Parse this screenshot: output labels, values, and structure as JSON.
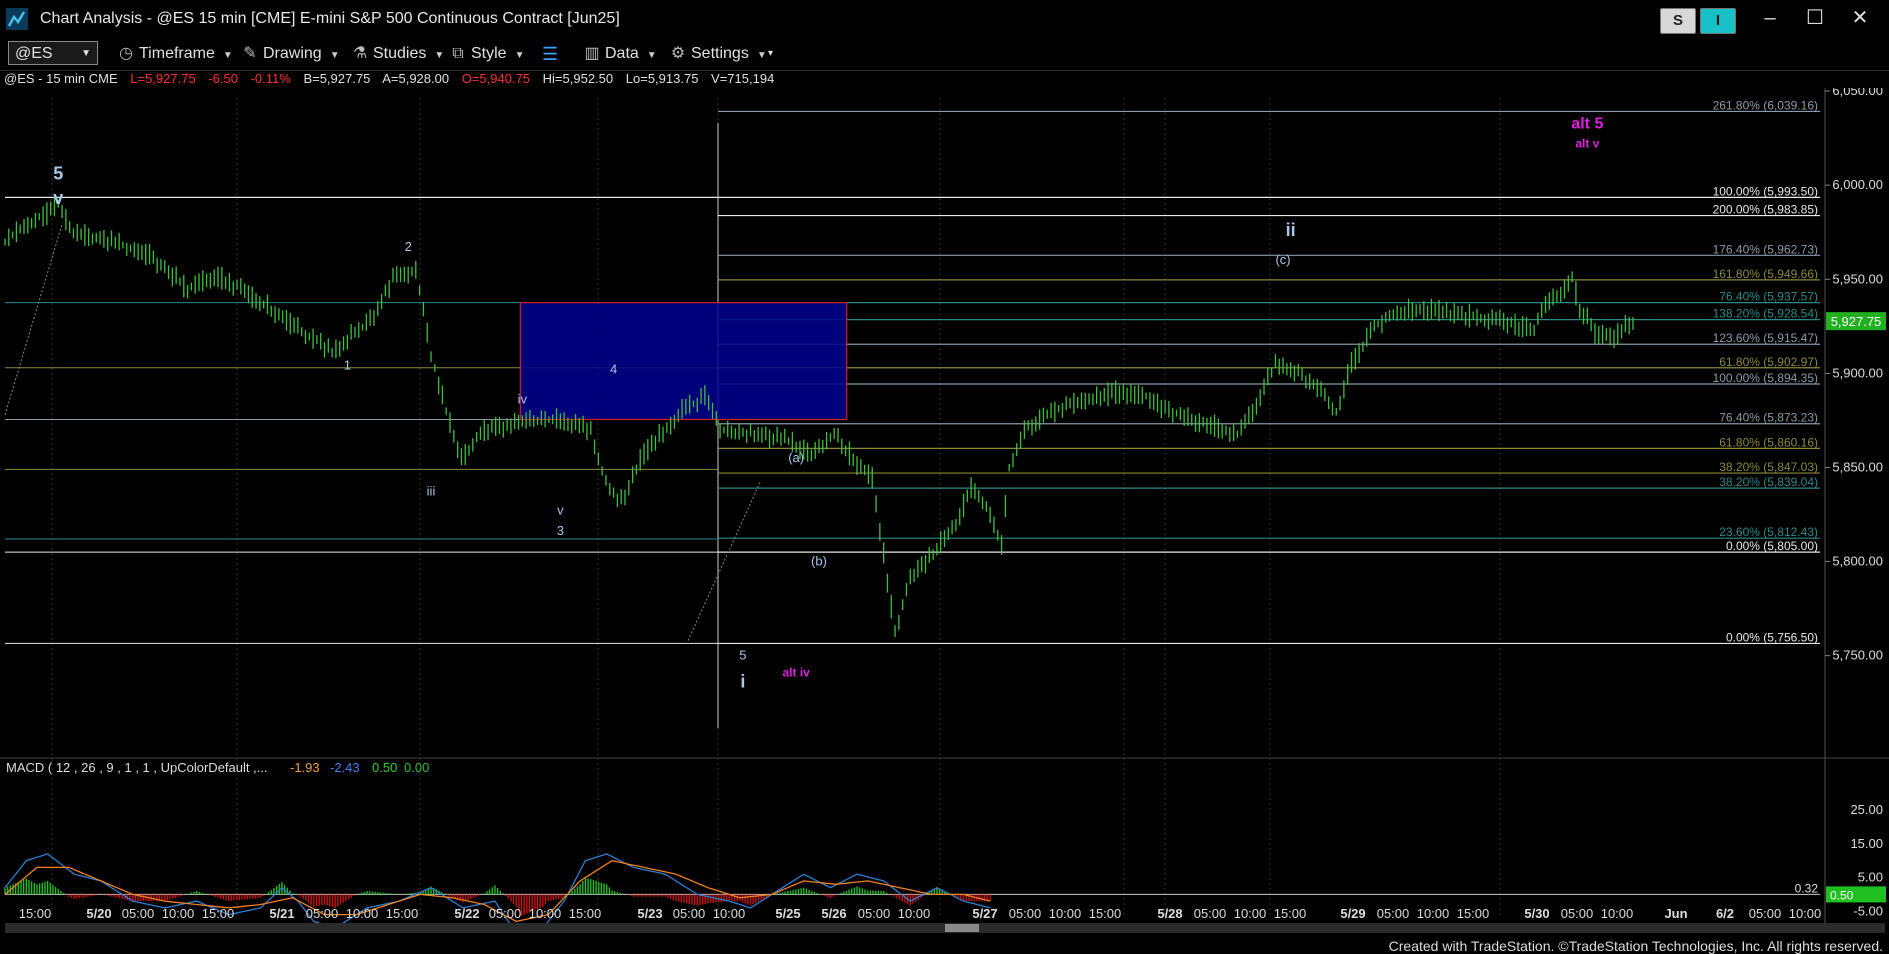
{
  "window": {
    "title": "Chart Analysis - @ES 15 min [CME] E-mini S&P 500 Continuous Contract [Jun25]",
    "s_button": "S",
    "i_button": "I",
    "minimize": "–",
    "maximize": "☐",
    "close": "✕"
  },
  "toolbar": {
    "symbol": "@ES",
    "timeframe_label": "Timeframe",
    "drawing_label": "Drawing",
    "studies_label": "Studies",
    "style_label": "Style",
    "data_label": "Data",
    "settings_label": "Settings"
  },
  "infobar": {
    "symbol": "@ES - 15 min  CME",
    "last": "L=5,927.75",
    "change": "-6.50",
    "pct": "-0.11%",
    "bid": "B=5,927.75",
    "ask": "A=5,928.00",
    "open": "O=5,940.75",
    "high": "Hi=5,952.50",
    "low": "Lo=5,913.75",
    "volume": "V=715,194"
  },
  "colors": {
    "background": "#000000",
    "price": "#3fbf3f",
    "white_line": "#e8e8e8",
    "gray_line": "#8a9aa8",
    "olive_line": "#8a8a3a",
    "teal_line": "#2a8a8a",
    "box_fill": "#00008f",
    "box_border": "#d02020",
    "magenta": "#e020e0",
    "wave_label": "#a8c8e8",
    "neg": "#ff3030",
    "pos": "#30d030",
    "last_price_bg": "#20b020",
    "macd_line": "#2a7fd4",
    "signal_line": "#f08020",
    "hist_pos": "#20c020",
    "hist_neg": "#d01010"
  },
  "chart_data": {
    "type": "line",
    "title": "@ES - 15 min CME",
    "price_axis_ticks": [
      "6,050.00",
      "6,000.00",
      "5,950.00",
      "5,900.00",
      "5,850.00",
      "5,800.00",
      "5,750.00"
    ],
    "y_range": [
      5702,
      6058
    ],
    "last_price_label": "5,927.75",
    "time_axis_ticks": [
      "15:00",
      "5/20",
      "05:00",
      "10:00",
      "15:00",
      "5/21",
      "05:00",
      "10:00",
      "15:00",
      "5/22",
      "05:00",
      "10:00",
      "15:00",
      "5/23",
      "05:00",
      "10:00",
      "5/25",
      "5/26",
      "05:00",
      "10:00",
      "5/27",
      "05:00",
      "10:00",
      "15:00",
      "5/28",
      "05:00",
      "10:00",
      "15:00",
      "5/29",
      "05:00",
      "10:00",
      "15:00",
      "5/30",
      "05:00",
      "10:00",
      "Jun",
      "6/2",
      "05:00",
      "10:00"
    ],
    "price_series_anchors": [
      [
        0,
        5970
      ],
      [
        3,
        5980
      ],
      [
        6,
        5986
      ],
      [
        7,
        5990
      ],
      [
        9,
        5975
      ],
      [
        14,
        5970
      ],
      [
        19,
        5963
      ],
      [
        24,
        5945
      ],
      [
        28,
        5952
      ],
      [
        33,
        5940
      ],
      [
        38,
        5925
      ],
      [
        43,
        5912
      ],
      [
        48,
        5928
      ],
      [
        51,
        5950
      ],
      [
        54,
        5955
      ],
      [
        56,
        5910
      ],
      [
        58,
        5880
      ],
      [
        60,
        5855
      ],
      [
        63,
        5870
      ],
      [
        68,
        5874
      ],
      [
        73,
        5876
      ],
      [
        77,
        5870
      ],
      [
        79,
        5842
      ],
      [
        81,
        5832
      ],
      [
        84,
        5858
      ],
      [
        89,
        5880
      ],
      [
        92,
        5888
      ],
      [
        94,
        5870
      ],
      [
        98,
        5868
      ],
      [
        103,
        5864
      ],
      [
        106,
        5856
      ],
      [
        109,
        5868
      ],
      [
        112,
        5852
      ],
      [
        114,
        5845
      ],
      [
        116,
        5790
      ],
      [
        117,
        5762
      ],
      [
        119,
        5790
      ],
      [
        122,
        5805
      ],
      [
        125,
        5820
      ],
      [
        127,
        5840
      ],
      [
        129,
        5830
      ],
      [
        131,
        5808
      ],
      [
        132,
        5850
      ],
      [
        134,
        5870
      ],
      [
        138,
        5880
      ],
      [
        142,
        5886
      ],
      [
        146,
        5890
      ],
      [
        150,
        5888
      ],
      [
        153,
        5880
      ],
      [
        156,
        5876
      ],
      [
        159,
        5872
      ],
      [
        162,
        5868
      ],
      [
        164,
        5880
      ],
      [
        167,
        5905
      ],
      [
        170,
        5900
      ],
      [
        173,
        5890
      ],
      [
        175,
        5880
      ],
      [
        177,
        5905
      ],
      [
        180,
        5925
      ],
      [
        183,
        5932
      ],
      [
        186,
        5935
      ],
      [
        190,
        5932
      ],
      [
        194,
        5930
      ],
      [
        198,
        5926
      ],
      [
        201,
        5924
      ],
      [
        203,
        5940
      ],
      [
        205,
        5945
      ],
      [
        206,
        5950
      ],
      [
        207,
        5935
      ],
      [
        209,
        5922
      ],
      [
        211,
        5918
      ],
      [
        214,
        5928
      ]
    ],
    "fib_levels": [
      {
        "label": "261.80% (6,039.16)",
        "value": 6039.16,
        "color": "gray"
      },
      {
        "label": "100.00% (5,993.50)",
        "value": 5993.5,
        "color": "white"
      },
      {
        "label": "200.00% (5,983.85)",
        "value": 5983.85,
        "color": "white"
      },
      {
        "label": "176.40% (5,962.73)",
        "value": 5962.73,
        "color": "gray"
      },
      {
        "label": "161.80% (5,949.66)",
        "value": 5949.66,
        "color": "olive"
      },
      {
        "label": "76.40% (5,937.57)",
        "value": 5937.57,
        "color": "teal"
      },
      {
        "label": "138.20% (5,928.54)",
        "value": 5928.54,
        "color": "teal"
      },
      {
        "label": "123.60% (5,915.47)",
        "value": 5915.47,
        "color": "gray"
      },
      {
        "label": "61.80% (5,902.97)",
        "value": 5902.97,
        "color": "olive"
      },
      {
        "label": "100.00% (5,894.35)",
        "value": 5894.35,
        "color": "gray"
      },
      {
        "label": "76.40% (5,873.23)",
        "value": 5873.23,
        "color": "gray"
      },
      {
        "label": "61.80% (5,860.16)",
        "value": 5860.16,
        "color": "olive"
      },
      {
        "label": "38.20% (5,847.03)",
        "value": 5847.03,
        "color": "olive"
      },
      {
        "label": "38.20% (5,839.04)",
        "value": 5839.04,
        "color": "teal"
      },
      {
        "label": "23.60% (5,812.43)",
        "value": 5812.43,
        "color": "teal"
      },
      {
        "label": "0.00% (5,805.00)",
        "value": 5805.0,
        "color": "white"
      },
      {
        "label": "0.00% (5,756.50)",
        "value": 5756.5,
        "color": "white"
      }
    ],
    "wave_labels": [
      {
        "text": "5",
        "bar": 7,
        "value": 6003,
        "size": "big"
      },
      {
        "text": "v",
        "bar": 7,
        "value": 5990,
        "size": "big"
      },
      {
        "text": "2",
        "bar": 53,
        "value": 5965,
        "size": "small"
      },
      {
        "text": "1",
        "bar": 45,
        "value": 5902,
        "size": "small"
      },
      {
        "text": "iii",
        "bar": 56,
        "value": 5835,
        "size": "small"
      },
      {
        "text": "iv",
        "bar": 68,
        "value": 5884,
        "size": "small"
      },
      {
        "text": "4",
        "bar": 80,
        "value": 5900,
        "size": "small"
      },
      {
        "text": "v",
        "bar": 73,
        "value": 5825,
        "size": "small"
      },
      {
        "text": "3",
        "bar": 73,
        "value": 5814,
        "size": "small"
      },
      {
        "text": "(a)",
        "bar": 104,
        "value": 5853,
        "size": "small"
      },
      {
        "text": "(b)",
        "bar": 107,
        "value": 5798,
        "size": "small"
      },
      {
        "text": "5",
        "bar": 97,
        "value": 5748,
        "size": "small"
      },
      {
        "text": "i",
        "bar": 97,
        "value": 5733,
        "size": "big"
      },
      {
        "text": "(c)",
        "bar": 168,
        "value": 5958,
        "size": "small"
      },
      {
        "text": "ii",
        "bar": 169,
        "value": 5973,
        "size": "big"
      }
    ],
    "alt_labels": [
      {
        "text": "alt 5",
        "bar": 208,
        "value": 6030,
        "size": "big"
      },
      {
        "text": "alt v",
        "bar": 208,
        "value": 6020,
        "size": "small"
      },
      {
        "text": "alt iv",
        "bar": 104,
        "value": 5739,
        "size": "small"
      }
    ],
    "box": {
      "start_bar": 126,
      "end_bar": 168,
      "high": 5937.57,
      "low": 5875.5
    },
    "macd": {
      "label": "MACD ( 12 , 26 , 9 , 1 , 1 , UpColorDefault ,...",
      "macd_value": "-1.93",
      "signal_value": "-2.43",
      "hist_value": "0.50",
      "zero_value": "0.00",
      "axis_ticks": [
        "25.00",
        "15.00",
        "5.00",
        "-5.00"
      ],
      "y_range": [
        -7,
        28
      ],
      "current_labels": [
        "0.32",
        "0.50"
      ],
      "macd_anchors": [
        [
          0,
          2
        ],
        [
          4,
          10
        ],
        [
          8,
          12
        ],
        [
          13,
          6
        ],
        [
          18,
          4
        ],
        [
          24,
          -2
        ],
        [
          30,
          -4
        ],
        [
          36,
          -2
        ],
        [
          42,
          -6
        ],
        [
          48,
          -4
        ],
        [
          52,
          2
        ],
        [
          55,
          -2
        ],
        [
          58,
          -8
        ],
        [
          62,
          -10
        ],
        [
          68,
          -4
        ],
        [
          74,
          -2
        ],
        [
          80,
          2
        ],
        [
          86,
          -4
        ],
        [
          92,
          -2
        ],
        [
          97,
          -14
        ],
        [
          101,
          -10
        ],
        [
          105,
          -2
        ],
        [
          109,
          10
        ],
        [
          113,
          12
        ],
        [
          118,
          8
        ],
        [
          124,
          6
        ],
        [
          130,
          0
        ],
        [
          136,
          -2
        ],
        [
          140,
          -4
        ],
        [
          146,
          2
        ],
        [
          150,
          6
        ],
        [
          155,
          2
        ],
        [
          160,
          6
        ],
        [
          165,
          4
        ],
        [
          170,
          -2
        ],
        [
          175,
          2
        ],
        [
          180,
          -2
        ],
        [
          185,
          -4
        ]
      ],
      "signal_anchors": [
        [
          0,
          0
        ],
        [
          6,
          8
        ],
        [
          12,
          8
        ],
        [
          18,
          4
        ],
        [
          24,
          0
        ],
        [
          30,
          -2
        ],
        [
          36,
          -3
        ],
        [
          42,
          -4
        ],
        [
          48,
          -3
        ],
        [
          54,
          -1
        ],
        [
          60,
          -6
        ],
        [
          66,
          -6
        ],
        [
          72,
          -3
        ],
        [
          78,
          0
        ],
        [
          84,
          -1
        ],
        [
          90,
          -3
        ],
        [
          96,
          -8
        ],
        [
          102,
          -6
        ],
        [
          108,
          4
        ],
        [
          114,
          10
        ],
        [
          120,
          8
        ],
        [
          126,
          6
        ],
        [
          132,
          2
        ],
        [
          138,
          -1
        ],
        [
          144,
          0
        ],
        [
          150,
          4
        ],
        [
          156,
          3
        ],
        [
          162,
          4
        ],
        [
          168,
          2
        ],
        [
          174,
          0
        ],
        [
          180,
          0
        ],
        [
          185,
          -2
        ]
      ]
    }
  },
  "footer": "Created with TradeStation. ©TradeStation Technologies, Inc. All rights reserved."
}
